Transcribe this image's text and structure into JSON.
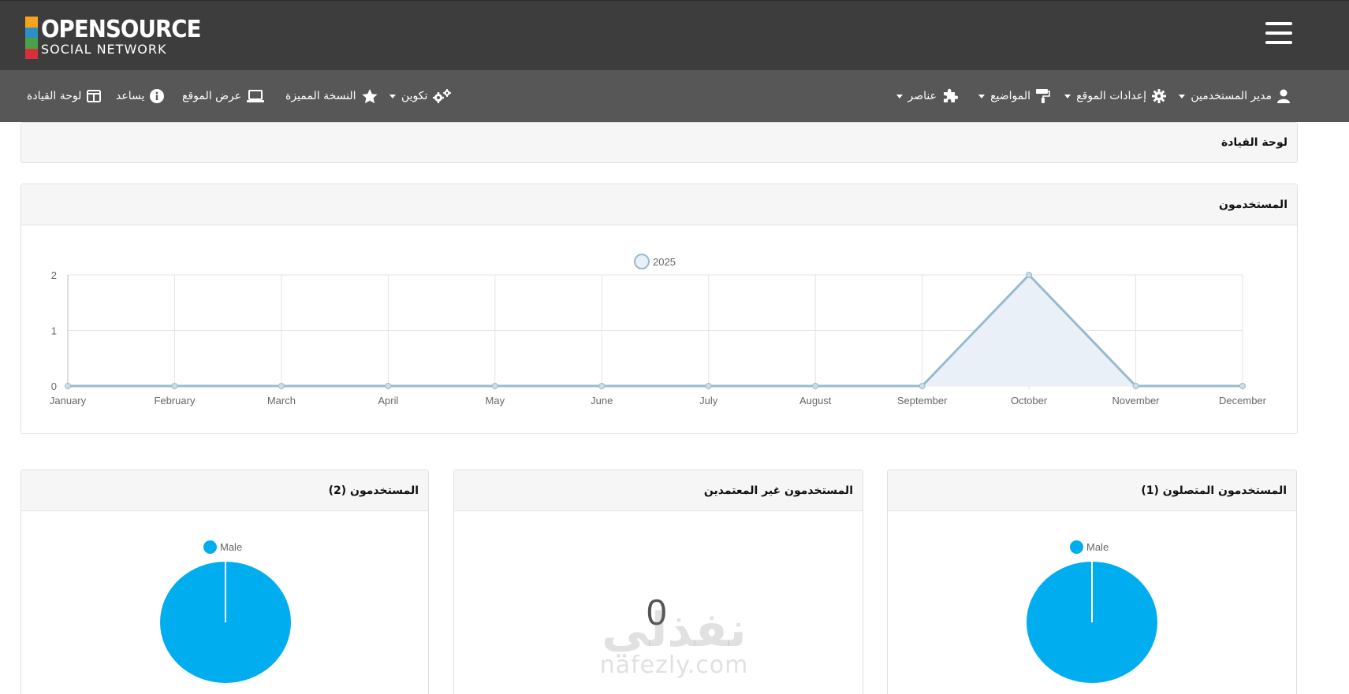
{
  "brand": {
    "line1": "OPENSOURCE",
    "line2": "SOCIAL NETWORK",
    "bar_colors": [
      "#f7a41d",
      "#2b8fc6",
      "#4aa146",
      "#d92e3e"
    ]
  },
  "nav_left": {
    "dashboard": "لوحة القيادة",
    "help": "يساعد",
    "view_site": "عرض الموقع",
    "premium": "النسخة المميزة",
    "configure": "تكوين"
  },
  "nav_right": {
    "components": "عناصر",
    "themes": "المواضيع",
    "site_settings": "إعدادات الموقع",
    "user_manager": "مدير المستخدمين"
  },
  "breadcrumb": {
    "title": "لوحة القيادة"
  },
  "users_chart_card": {
    "title": "المستخدمون"
  },
  "stats": {
    "users_title": "المستخدمون (2)",
    "unvalidated_title": "المستخدمون غير المعتمدين",
    "unvalidated_count": "0",
    "online_title": "المستخدمون المتصلون (1)"
  },
  "watermark": {
    "arabic": "نفذلي",
    "latin": "nafezly.com"
  },
  "colors": {
    "topbar": "#3d3d3d",
    "navbar": "#575757",
    "line": "#97bbcd",
    "area_fill": "#eaf0f8",
    "pie_blue": "#00adef"
  },
  "chart_data": [
    {
      "type": "line",
      "title": "",
      "categories": [
        "January",
        "February",
        "March",
        "April",
        "May",
        "June",
        "July",
        "August",
        "September",
        "October",
        "November",
        "December"
      ],
      "series": [
        {
          "name": "2025",
          "values": [
            0,
            0,
            0,
            0,
            0,
            0,
            0,
            0,
            0,
            2,
            0,
            0
          ]
        }
      ],
      "ylim": [
        0,
        2
      ],
      "yticks": [
        0,
        1,
        2
      ],
      "grid": true,
      "legend": "top-center"
    },
    {
      "type": "pie",
      "title": "",
      "labels": [
        "Male"
      ],
      "values": [
        2
      ],
      "legend": "top-center"
    },
    {
      "type": "pie",
      "title": "",
      "labels": [
        "Male"
      ],
      "values": [
        1
      ],
      "legend": "top-center"
    }
  ]
}
